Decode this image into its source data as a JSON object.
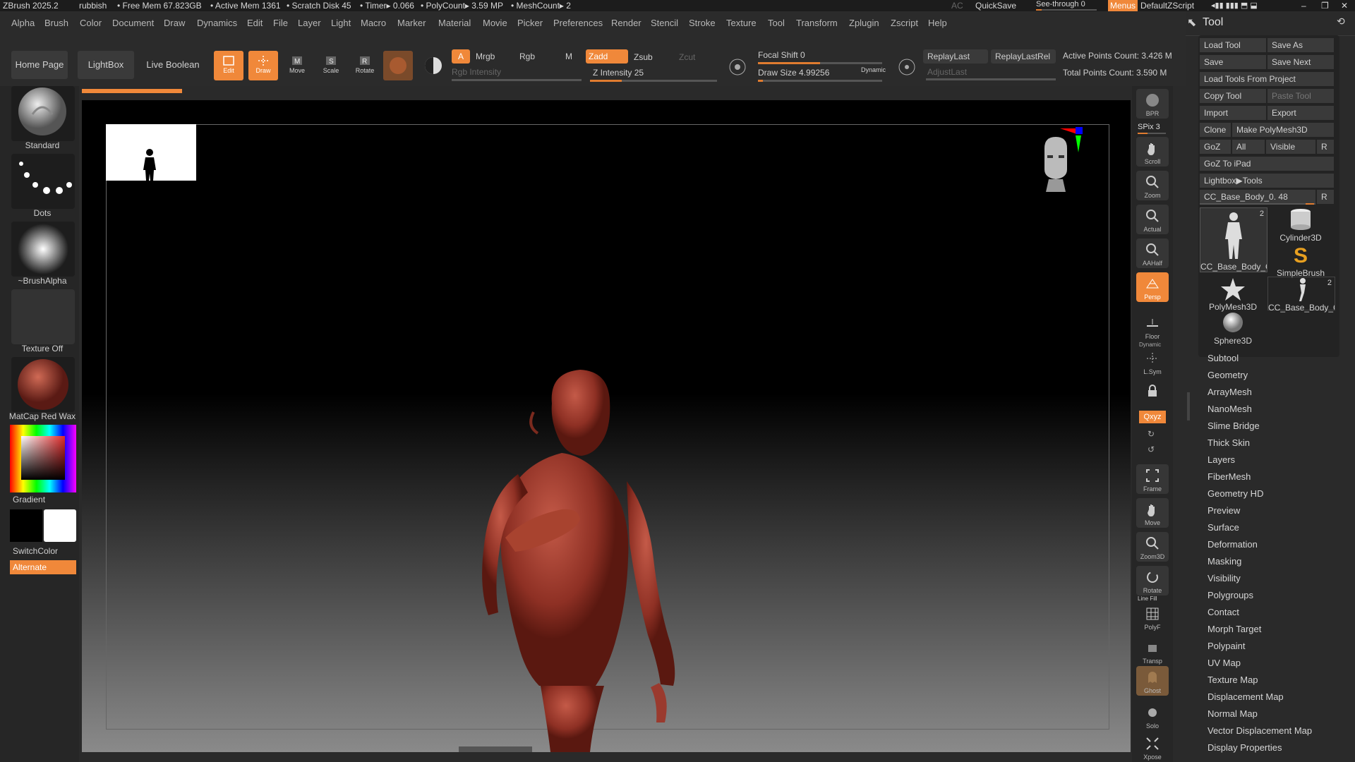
{
  "titlebar": {
    "app": "ZBrush 2025.2",
    "project": "rubbish",
    "free_mem": "• Free Mem 67.823GB",
    "active_mem": "• Active Mem 1361",
    "scratch": "• Scratch Disk 45",
    "timer": "• Timer▸ 0.066",
    "polycount": "• PolyCount▸ 3.59 MP",
    "meshcount": "• MeshCount▸ 2",
    "ac": "AC",
    "quicksave": "QuickSave",
    "see_through": "See-through  0",
    "menus": "Menus",
    "script": "DefaultZScript"
  },
  "menu": [
    "Alpha",
    "Brush",
    "Color",
    "Document",
    "Draw",
    "Dynamics",
    "Edit",
    "File",
    "Layer",
    "Light",
    "Macro",
    "Marker",
    "Material",
    "Movie",
    "Picker",
    "Preferences",
    "Render",
    "Stencil",
    "Stroke",
    "Texture",
    "Tool",
    "Transform",
    "Zplugin",
    "Zscript",
    "Help"
  ],
  "toolbar": {
    "home": "Home Page",
    "lightbox": "LightBox",
    "live_boolean": "Live Boolean",
    "edit": "Edit",
    "draw": "Draw",
    "move": "Move",
    "scale": "Scale",
    "rotate": "Rotate",
    "a": "A",
    "mrgb": "Mrgb",
    "rgb": "Rgb",
    "m": "M",
    "rgb_intensity": "Rgb Intensity",
    "zadd": "Zadd",
    "zsub": "Zsub",
    "zcut": "Zcut",
    "z_intensity": "Z Intensity 25",
    "focal_shift": "Focal Shift 0",
    "draw_size": "Draw Size 4.99256",
    "dynamic": "Dynamic",
    "replay_last": "ReplayLast",
    "replay_last_rel": "ReplayLastRel",
    "adjust_last": "AdjustLast",
    "active_points": "Active Points Count: 3.426 M",
    "total_points": "Total Points Count: 3.590 M",
    "z_intensity_value": 25,
    "z_intensity_fraction": 0.25,
    "focal_fraction": 0.5,
    "draw_size_fraction": 0.04
  },
  "leftshelf": {
    "brush": "Standard",
    "stroke": "Dots",
    "alpha": "~BrushAlpha",
    "texture": "Texture Off",
    "material": "MatCap Red Wax",
    "gradient": "Gradient",
    "switch_color": "SwitchColor",
    "alternate": "Alternate"
  },
  "rightshelf": {
    "bpr": "BPR",
    "spix": "SPix 3",
    "items": [
      "Scroll",
      "Zoom",
      "Actual",
      "AAHalf",
      "Persp",
      "Floor",
      "L.Sym",
      "",
      "Frame",
      "Move",
      "Zoom3D",
      "Rotate",
      "PolyF",
      "Transp",
      "Ghost",
      "Solo",
      "Xpose"
    ],
    "dynamic": "Dynamic",
    "xyz": "Qxyz",
    "line_fill": "Line Fill"
  },
  "toolpanel": {
    "title": "Tool",
    "load_tool": "Load Tool",
    "save_as": "Save As",
    "save": "Save",
    "save_next": "Save Next",
    "load_from_project": "Load Tools From Project",
    "copy_tool": "Copy Tool",
    "paste_tool": "Paste Tool",
    "import": "Import",
    "export": "Export",
    "clone": "Clone",
    "make_polymesh": "Make PolyMesh3D",
    "goz": "GoZ",
    "all": "All",
    "visible": "Visible",
    "r": "R",
    "goz_ipad": "GoZ To iPad",
    "lightbox_tools": "Lightbox▶Tools",
    "current_tool": "CC_Base_Body_0. 48",
    "tiles": [
      {
        "label": "CC_Base_Body_C",
        "count": "2"
      },
      {
        "label": "Cylinder3D",
        "count": ""
      },
      {
        "label": "SimpleBrush",
        "count": ""
      },
      {
        "label": "PolyMesh3D",
        "count": ""
      },
      {
        "label": "CC_Base_Body_C",
        "count": "2"
      },
      {
        "label": "Sphere3D",
        "count": ""
      }
    ],
    "subpalettes": [
      "Subtool",
      "Geometry",
      "ArrayMesh",
      "NanoMesh",
      "Slime Bridge",
      "Thick Skin",
      "Layers",
      "FiberMesh",
      "Geometry HD",
      "Preview",
      "Surface",
      "Deformation",
      "Masking",
      "Visibility",
      "Polygroups",
      "Contact",
      "Morph Target",
      "Polypaint",
      "UV Map",
      "Texture Map",
      "Displacement Map",
      "Normal Map",
      "Vector Displacement Map",
      "Display Properties"
    ]
  },
  "colors": {
    "accent": "#f0883a",
    "panel": "#2a2a2a",
    "model": "#9a3a2e"
  }
}
